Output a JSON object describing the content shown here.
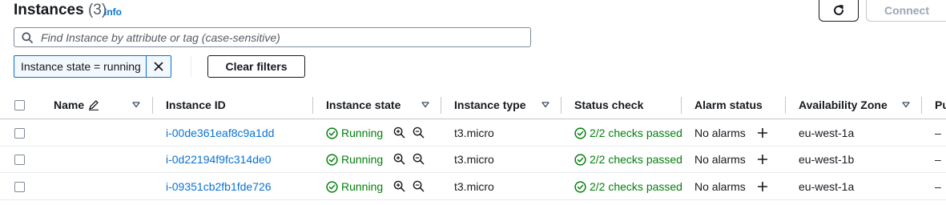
{
  "header": {
    "title": "Instances",
    "count": "(3)",
    "info_link": "Info",
    "refresh_icon": "refresh-icon",
    "connect_label": "Connect"
  },
  "search": {
    "placeholder": "Find Instance by attribute or tag (case-sensitive)",
    "value": "",
    "icon": "search-icon"
  },
  "filters": {
    "token_label": "Instance state = running",
    "clear_label": "Clear filters"
  },
  "table": {
    "columns": [
      "Name",
      "Instance ID",
      "Instance state",
      "Instance type",
      "Status check",
      "Alarm status",
      "Availability Zone",
      "Pu"
    ],
    "rows": [
      {
        "name": "",
        "id": "i-00de361eaf8c9a1dd",
        "state": "Running",
        "type": "t3.micro",
        "status": "2/2 checks passed",
        "alarm": "No alarms",
        "az": "eu-west-1a",
        "public": "–"
      },
      {
        "name": "",
        "id": "i-0d22194f9fc314de0",
        "state": "Running",
        "type": "t3.micro",
        "status": "2/2 checks passed",
        "alarm": "No alarms",
        "az": "eu-west-1b",
        "public": "–"
      },
      {
        "name": "",
        "id": "i-09351cb2fb1fde726",
        "state": "Running",
        "type": "t3.micro",
        "status": "2/2 checks passed",
        "alarm": "No alarms",
        "az": "eu-west-1a",
        "public": "–"
      }
    ]
  },
  "colors": {
    "link": "#0972d3",
    "success": "#037f0c",
    "border": "#c6c6cd",
    "text": "#16191f"
  }
}
